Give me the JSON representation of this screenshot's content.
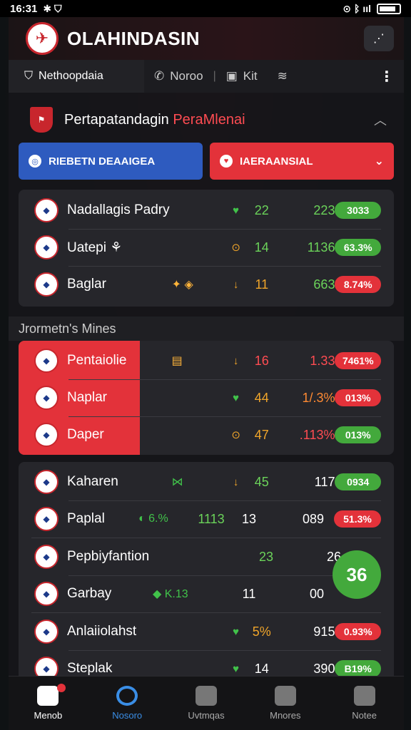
{
  "status": {
    "time": "16:31",
    "icons_left": "✱ ⛉",
    "icons_right": "⊙ ᛒ ııl"
  },
  "header": {
    "title": "OLAHINDASIN",
    "logo_glyph": "✈",
    "action_glyph": "⋰"
  },
  "tabs": {
    "main_label": "Nethoopdaia",
    "items": [
      {
        "label": "Noroo",
        "glyph": "✆"
      },
      {
        "label": "Kit",
        "glyph": "▣"
      }
    ],
    "filter_glyph": "≋",
    "more_glyph": "⋮"
  },
  "section": {
    "title_pre": "Pertapatandagin ",
    "title_hl": "PeraMlenai",
    "caret": "︿"
  },
  "filters": {
    "left": {
      "label": "RIEBETN DEAAIGEA",
      "glyph": "◎"
    },
    "right": {
      "label": "IAERAANSIAL",
      "glyph": "♥",
      "chevron": "⌄"
    }
  },
  "card1": [
    {
      "name": "Nadallagis Padry",
      "mini": "",
      "ind": "♥",
      "val": "22",
      "stat": "223",
      "badge": "3033"
    },
    {
      "name": "Uatepi ⚘",
      "mini": "",
      "ind": "⊙",
      "val": "14",
      "stat": "1136",
      "badge": "63.3%"
    },
    {
      "name": "Baglar",
      "mini": "✦ ◈",
      "ind": "↓",
      "val": "11",
      "stat": "663",
      "badge": "8.74%"
    }
  ],
  "subhead": "Jrormetn's Mines",
  "card2": [
    {
      "name": "Pentaiolie",
      "mini": "▤",
      "ind": "↓",
      "val": "16",
      "stat": "1.33",
      "badge": "7461%"
    },
    {
      "name": "Naplar",
      "mini": "",
      "ind": "♥",
      "val": "44",
      "stat": "1/.3%",
      "badge": "013%"
    },
    {
      "name": "Daper",
      "mini": "",
      "ind": "⊙",
      "val": "47",
      "stat": ".113%",
      "badge": "013%"
    }
  ],
  "card3": [
    {
      "name": "Kaharen",
      "mini": "⋈",
      "ind": "↓",
      "val": "45",
      "stat": "117",
      "badge": "0934"
    },
    {
      "name": "Paplal",
      "mini": "◐ 6.%",
      "extra": "1113",
      "ind": "",
      "val": "13",
      "stat": "089",
      "badge": "51.3%"
    },
    {
      "name": "Pepbiyfantion",
      "mini": "",
      "ind": "",
      "val": "23",
      "stat": "26",
      "badge": ""
    },
    {
      "name": "Garbay",
      "mini": "◆ K.13",
      "ind": "",
      "val": "11",
      "stat": "00",
      "badge": ""
    },
    {
      "name": "Anlaiiolahst",
      "mini": "",
      "ind": "♥",
      "val": "5%",
      "stat": "915",
      "badge": "0.93%"
    },
    {
      "name": "Steplak",
      "mini": "",
      "ind": "♥",
      "val": "14",
      "stat": "390",
      "badge": "B19%"
    }
  ],
  "big_badge": "36",
  "nav": [
    {
      "label": "Menob"
    },
    {
      "label": "Nosoro"
    },
    {
      "label": "Uvtmqas"
    },
    {
      "label": "Mnores"
    },
    {
      "label": "Notee"
    }
  ]
}
